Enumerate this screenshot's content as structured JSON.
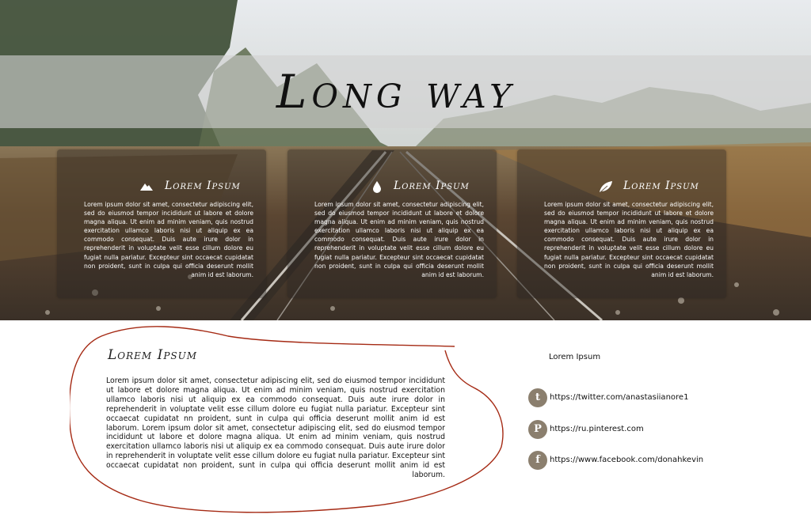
{
  "hero": {
    "title": "Long way"
  },
  "cards": [
    {
      "icon": "mountain-icon",
      "title": "Lorem Ipsum",
      "body": "Lorem ipsum dolor sit amet, consectetur adipiscing elit, sed do eiusmod tempor incididunt ut labore et dolore magna aliqua. Ut enim ad minim veniam, quis nostrud exercitation ullamco laboris nisi ut aliquip ex ea commodo consequat. Duis aute irure dolor in reprehenderit in voluptate velit esse cillum dolore eu fugiat nulla pariatur. Excepteur sint occaecat cupidatat non proident, sunt in culpa qui officia deserunt mollit anim id est laborum."
    },
    {
      "icon": "water-drop-icon",
      "title": "Lorem Ipsum",
      "body": "Lorem ipsum dolor sit amet, consectetur adipiscing elit, sed do eiusmod tempor incididunt ut labore et dolore magna aliqua. Ut enim ad minim veniam, quis nostrud exercitation ullamco laboris nisi ut aliquip ex ea commodo consequat. Duis aute irure dolor in reprehenderit in voluptate velit esse cillum dolore eu fugiat nulla pariatur. Excepteur sint occaecat cupidatat non proident, sunt in culpa qui officia deserunt mollit anim id est laborum."
    },
    {
      "icon": "leaf-icon",
      "title": "Lorem Ipsum",
      "body": "Lorem ipsum dolor sit amet, consectetur adipiscing elit, sed do eiusmod tempor incididunt ut labore et dolore magna aliqua. Ut enim ad minim veniam, quis nostrud exercitation ullamco laboris nisi ut aliquip ex ea commodo consequat. Duis aute irure dolor in reprehenderit in voluptate velit esse cillum dolore eu fugiat nulla pariatur. Excepteur sint occaecat cupidatat non proident, sunt in culpa qui officia deserunt mollit anim id est laborum."
    }
  ],
  "section": {
    "title": "Lorem Ipsum",
    "body": "Lorem ipsum dolor sit amet, consectetur adipiscing elit, sed do eiusmod tempor incididunt ut labore et dolore magna aliqua. Ut enim ad minim veniam, quis nostrud exercitation ullamco laboris nisi ut aliquip ex ea commodo consequat. Duis aute irure dolor in reprehenderit in voluptate velit esse cillum dolore eu fugiat nulla pariatur. Excepteur sint occaecat cupidatat nn proident, sunt in culpa qui officia deserunt mollit anim id est laborum. Lorem ipsum dolor sit amet, consectetur adipiscing elit, sed do eiusmod tempor incididunt ut labore et dolore magna aliqua. Ut enim ad minim veniam, quis nostrud exercitation ullamco laboris nisi ut aliquip ex ea commodo consequat. Duis aute irure dolor in reprehenderit in voluptate velit esse cillum dolore eu fugiat nulla pariatur. Excepteur sint occaecat cupidatat non proident, sunt in culpa qui officia deserunt mollit anim id est laborum."
  },
  "social": {
    "heading": "Lorem Ipsum",
    "links": [
      {
        "icon": "twitter-icon",
        "glyph": "t",
        "url": "https://twitter.com/anastasiianore1"
      },
      {
        "icon": "pinterest-icon",
        "glyph": "P",
        "url": "https://ru.pinterest.com"
      },
      {
        "icon": "facebook-icon",
        "glyph": "f",
        "url": "https://www.facebook.com/donahkevin"
      }
    ]
  },
  "colors": {
    "accent_outline": "#a52a14",
    "social_icon_bg": "#8b7f6e"
  }
}
